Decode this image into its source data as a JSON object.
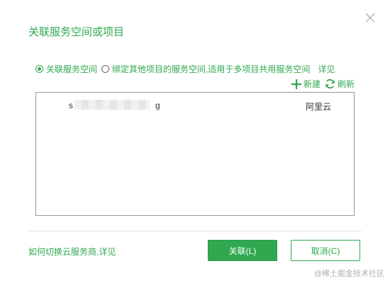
{
  "dialog": {
    "title": "关联服务空间或项目",
    "close_icon": "close-icon"
  },
  "options": {
    "radio_associate_label": "关联服务空间",
    "radio_associate_selected": true,
    "radio_bind_label": "绑定其他项目的服务空间,适用于多项目共用服务空间",
    "radio_bind_selected": false,
    "see_details": "详见"
  },
  "toolbar": {
    "new_label": "新建",
    "new_icon": "plus-icon",
    "refresh_label": "刷新",
    "refresh_icon": "refresh-icon"
  },
  "spaces": [
    {
      "name_start": "s",
      "name_end": "g",
      "provider": "阿里云"
    }
  ],
  "footer": {
    "help_text": "如何切换云服务商,",
    "help_link": "详见"
  },
  "buttons": {
    "associate": "关联(L)",
    "cancel": "取消(C)"
  },
  "watermark": "@稀土掘金技术社区",
  "colors": {
    "accent": "#2fa84f",
    "border": "#999999"
  }
}
